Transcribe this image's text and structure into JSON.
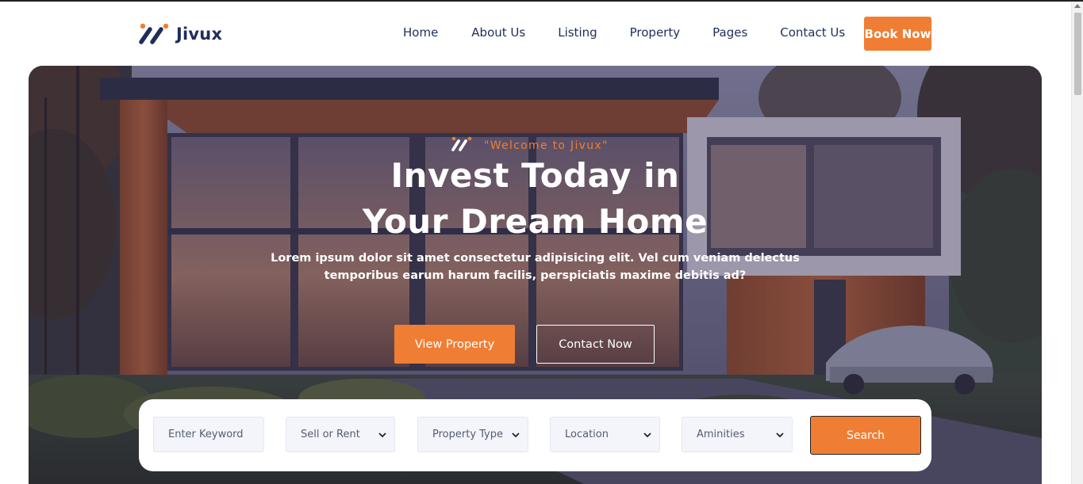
{
  "brand": {
    "name": "Jivux",
    "accent": "#ef7e34",
    "navy": "#1f2d5a"
  },
  "nav": {
    "items": [
      {
        "label": "Home"
      },
      {
        "label": "About Us"
      },
      {
        "label": "Listing"
      },
      {
        "label": "Property"
      },
      {
        "label": "Pages"
      },
      {
        "label": "Contact Us"
      }
    ],
    "cta": "Book Now"
  },
  "hero": {
    "welcome": "\"Welcome to Jivux\"",
    "title_line1": "Invest Today in",
    "title_line2": "Your Dream Home",
    "subtitle_line1": "Lorem ipsum dolor sit amet consectetur adipisicing elit. Vel cum veniam delectus",
    "subtitle_line2": "temporibus earum harum facilis, perspiciatis maxime debitis ad?",
    "primary_button": "View Property",
    "secondary_button": "Contact Now"
  },
  "search": {
    "keyword_placeholder": "Enter Keyword",
    "sell_or_rent": "Sell or Rent",
    "property_type": "Property Type",
    "location": "Location",
    "amenities": "Aminities",
    "button": "Search"
  }
}
